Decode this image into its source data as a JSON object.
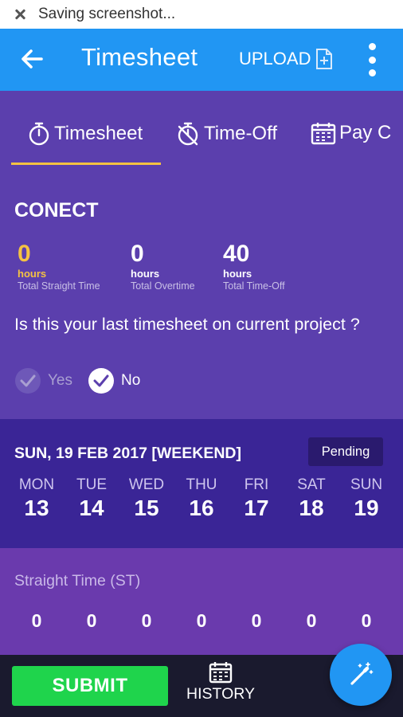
{
  "status_bar": {
    "text": "Saving screenshot..."
  },
  "app_bar": {
    "title": "Timesheet",
    "upload_label": "UPLOAD"
  },
  "tabs": [
    {
      "label": "Timesheet",
      "icon": "stopwatch-icon",
      "active": true
    },
    {
      "label": "Time-Off",
      "icon": "stopwatch-off-icon",
      "active": false
    },
    {
      "label": "Pay C",
      "icon": "calendar-icon",
      "active": false
    }
  ],
  "summary": {
    "company": "CONECT",
    "stats": [
      {
        "value": "0",
        "unit": "hours",
        "label": "Total Straight Time",
        "color": "#f5c242"
      },
      {
        "value": "0",
        "unit": "hours",
        "label": "Total Overtime"
      },
      {
        "value": "40",
        "unit": "hours",
        "label": "Total Time-Off"
      }
    ],
    "question": "Is this your last timesheet on current project ?",
    "options": {
      "yes": "Yes",
      "no": "No",
      "selected": "No"
    }
  },
  "week": {
    "date_label": "SUN, 19 FEB 2017 [WEEKEND]",
    "status": "Pending",
    "days": [
      {
        "name": "MON",
        "date": "13"
      },
      {
        "name": "TUE",
        "date": "14"
      },
      {
        "name": "WED",
        "date": "15"
      },
      {
        "name": "THU",
        "date": "16"
      },
      {
        "name": "FRI",
        "date": "17"
      },
      {
        "name": "SAT",
        "date": "18"
      },
      {
        "name": "SUN",
        "date": "19"
      }
    ]
  },
  "straight_time": {
    "label": "Straight Time (ST)",
    "values": [
      "0",
      "0",
      "0",
      "0",
      "0",
      "0",
      "0"
    ]
  },
  "bottom": {
    "submit_label": "SUBMIT",
    "history_label": "HISTORY"
  },
  "colors": {
    "primary": "#2196f3",
    "accent": "#f5c242",
    "submit": "#1fd44c",
    "background": "#5b3fad"
  }
}
